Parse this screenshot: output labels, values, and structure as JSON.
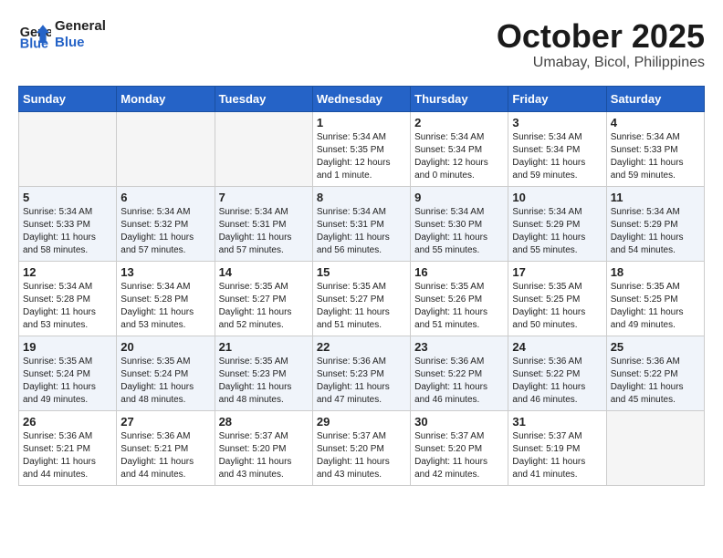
{
  "header": {
    "logo_line1": "General",
    "logo_line2": "Blue",
    "month": "October 2025",
    "location": "Umabay, Bicol, Philippines"
  },
  "days_of_week": [
    "Sunday",
    "Monday",
    "Tuesday",
    "Wednesday",
    "Thursday",
    "Friday",
    "Saturday"
  ],
  "weeks": [
    {
      "alt": false,
      "days": [
        {
          "num": "",
          "info": ""
        },
        {
          "num": "",
          "info": ""
        },
        {
          "num": "",
          "info": ""
        },
        {
          "num": "1",
          "info": "Sunrise: 5:34 AM\nSunset: 5:35 PM\nDaylight: 12 hours\nand 1 minute."
        },
        {
          "num": "2",
          "info": "Sunrise: 5:34 AM\nSunset: 5:34 PM\nDaylight: 12 hours\nand 0 minutes."
        },
        {
          "num": "3",
          "info": "Sunrise: 5:34 AM\nSunset: 5:34 PM\nDaylight: 11 hours\nand 59 minutes."
        },
        {
          "num": "4",
          "info": "Sunrise: 5:34 AM\nSunset: 5:33 PM\nDaylight: 11 hours\nand 59 minutes."
        }
      ]
    },
    {
      "alt": true,
      "days": [
        {
          "num": "5",
          "info": "Sunrise: 5:34 AM\nSunset: 5:33 PM\nDaylight: 11 hours\nand 58 minutes."
        },
        {
          "num": "6",
          "info": "Sunrise: 5:34 AM\nSunset: 5:32 PM\nDaylight: 11 hours\nand 57 minutes."
        },
        {
          "num": "7",
          "info": "Sunrise: 5:34 AM\nSunset: 5:31 PM\nDaylight: 11 hours\nand 57 minutes."
        },
        {
          "num": "8",
          "info": "Sunrise: 5:34 AM\nSunset: 5:31 PM\nDaylight: 11 hours\nand 56 minutes."
        },
        {
          "num": "9",
          "info": "Sunrise: 5:34 AM\nSunset: 5:30 PM\nDaylight: 11 hours\nand 55 minutes."
        },
        {
          "num": "10",
          "info": "Sunrise: 5:34 AM\nSunset: 5:29 PM\nDaylight: 11 hours\nand 55 minutes."
        },
        {
          "num": "11",
          "info": "Sunrise: 5:34 AM\nSunset: 5:29 PM\nDaylight: 11 hours\nand 54 minutes."
        }
      ]
    },
    {
      "alt": false,
      "days": [
        {
          "num": "12",
          "info": "Sunrise: 5:34 AM\nSunset: 5:28 PM\nDaylight: 11 hours\nand 53 minutes."
        },
        {
          "num": "13",
          "info": "Sunrise: 5:34 AM\nSunset: 5:28 PM\nDaylight: 11 hours\nand 53 minutes."
        },
        {
          "num": "14",
          "info": "Sunrise: 5:35 AM\nSunset: 5:27 PM\nDaylight: 11 hours\nand 52 minutes."
        },
        {
          "num": "15",
          "info": "Sunrise: 5:35 AM\nSunset: 5:27 PM\nDaylight: 11 hours\nand 51 minutes."
        },
        {
          "num": "16",
          "info": "Sunrise: 5:35 AM\nSunset: 5:26 PM\nDaylight: 11 hours\nand 51 minutes."
        },
        {
          "num": "17",
          "info": "Sunrise: 5:35 AM\nSunset: 5:25 PM\nDaylight: 11 hours\nand 50 minutes."
        },
        {
          "num": "18",
          "info": "Sunrise: 5:35 AM\nSunset: 5:25 PM\nDaylight: 11 hours\nand 49 minutes."
        }
      ]
    },
    {
      "alt": true,
      "days": [
        {
          "num": "19",
          "info": "Sunrise: 5:35 AM\nSunset: 5:24 PM\nDaylight: 11 hours\nand 49 minutes."
        },
        {
          "num": "20",
          "info": "Sunrise: 5:35 AM\nSunset: 5:24 PM\nDaylight: 11 hours\nand 48 minutes."
        },
        {
          "num": "21",
          "info": "Sunrise: 5:35 AM\nSunset: 5:23 PM\nDaylight: 11 hours\nand 48 minutes."
        },
        {
          "num": "22",
          "info": "Sunrise: 5:36 AM\nSunset: 5:23 PM\nDaylight: 11 hours\nand 47 minutes."
        },
        {
          "num": "23",
          "info": "Sunrise: 5:36 AM\nSunset: 5:22 PM\nDaylight: 11 hours\nand 46 minutes."
        },
        {
          "num": "24",
          "info": "Sunrise: 5:36 AM\nSunset: 5:22 PM\nDaylight: 11 hours\nand 46 minutes."
        },
        {
          "num": "25",
          "info": "Sunrise: 5:36 AM\nSunset: 5:22 PM\nDaylight: 11 hours\nand 45 minutes."
        }
      ]
    },
    {
      "alt": false,
      "days": [
        {
          "num": "26",
          "info": "Sunrise: 5:36 AM\nSunset: 5:21 PM\nDaylight: 11 hours\nand 44 minutes."
        },
        {
          "num": "27",
          "info": "Sunrise: 5:36 AM\nSunset: 5:21 PM\nDaylight: 11 hours\nand 44 minutes."
        },
        {
          "num": "28",
          "info": "Sunrise: 5:37 AM\nSunset: 5:20 PM\nDaylight: 11 hours\nand 43 minutes."
        },
        {
          "num": "29",
          "info": "Sunrise: 5:37 AM\nSunset: 5:20 PM\nDaylight: 11 hours\nand 43 minutes."
        },
        {
          "num": "30",
          "info": "Sunrise: 5:37 AM\nSunset: 5:20 PM\nDaylight: 11 hours\nand 42 minutes."
        },
        {
          "num": "31",
          "info": "Sunrise: 5:37 AM\nSunset: 5:19 PM\nDaylight: 11 hours\nand 41 minutes."
        },
        {
          "num": "",
          "info": ""
        }
      ]
    }
  ]
}
